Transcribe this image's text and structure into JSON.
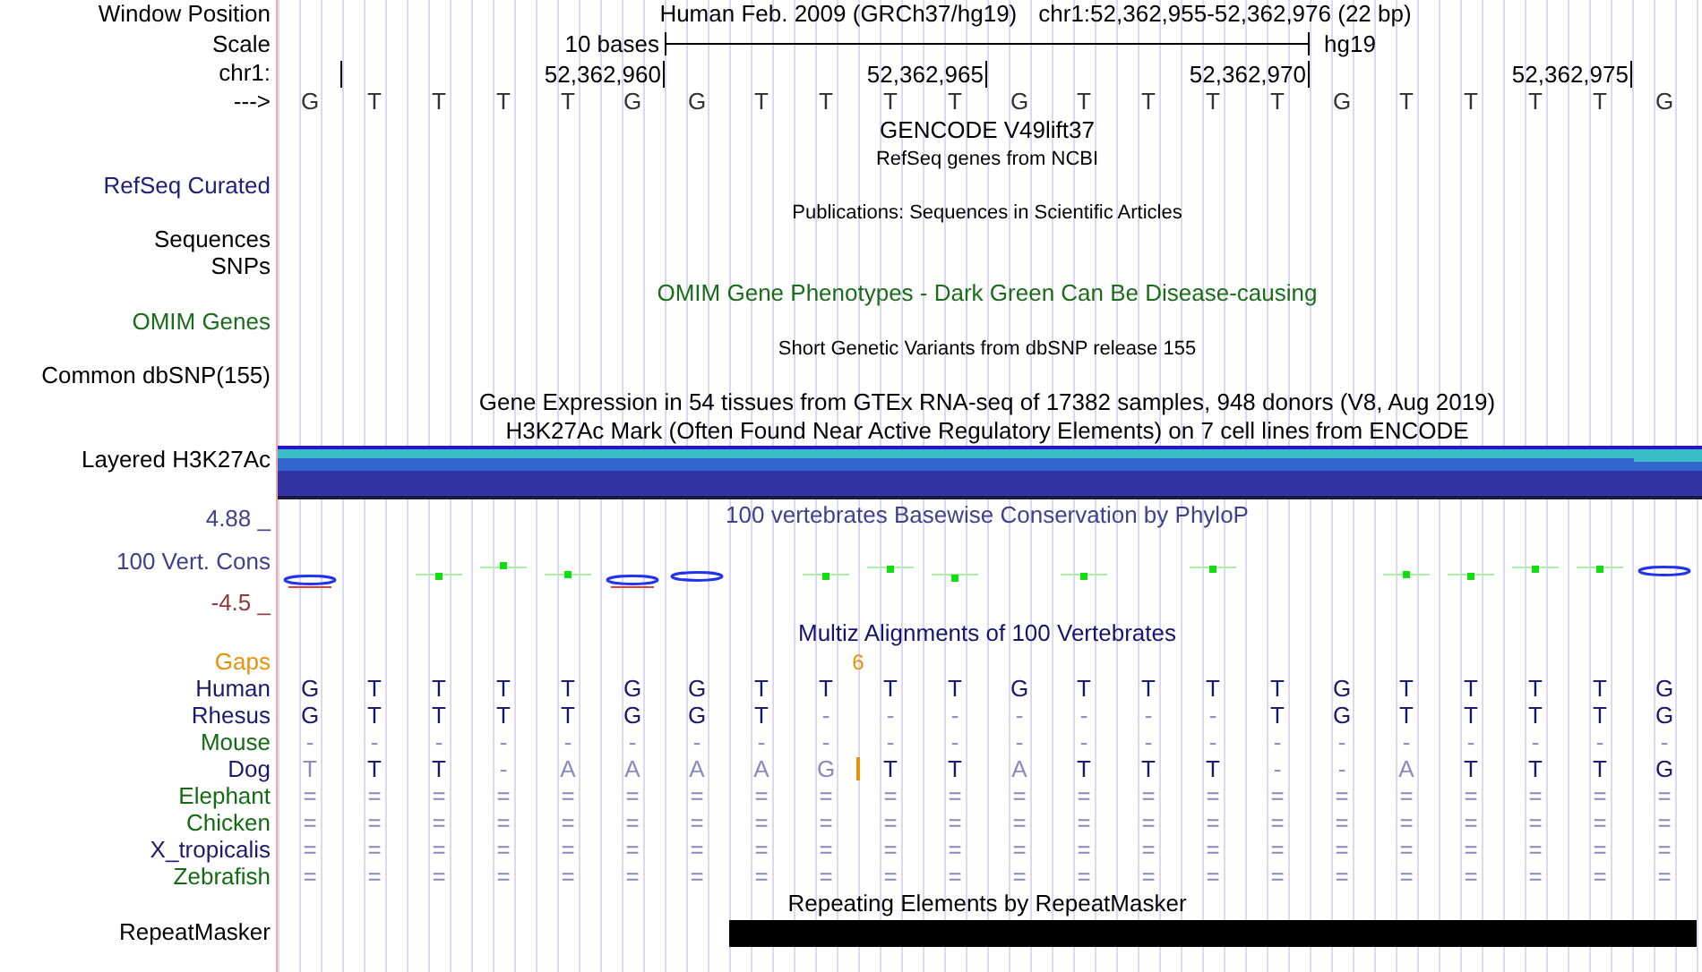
{
  "position": {
    "label": "Window Position",
    "assembly": "Human Feb. 2009 (GRCh37/hg19)",
    "range": "chr1:52,362,955-52,362,976 (22 bp)"
  },
  "scale": {
    "label": "Scale",
    "text": "10 bases",
    "db": "hg19"
  },
  "ruler": {
    "label": "chr1:",
    "ticks": [
      "52,362,960",
      "52,362,965",
      "52,362,970",
      "52,362,975"
    ]
  },
  "sequence": {
    "label": "--->",
    "bases": [
      "G",
      "T",
      "T",
      "T",
      "T",
      "G",
      "G",
      "T",
      "T",
      "T",
      "T",
      "G",
      "T",
      "T",
      "T",
      "T",
      "G",
      "T",
      "T",
      "T",
      "T",
      "G"
    ]
  },
  "tracks": [
    {
      "kind": "title",
      "text": "GENCODE V49lift37"
    },
    {
      "kind": "note",
      "text": "RefSeq genes from NCBI"
    },
    {
      "kind": "label",
      "label": "RefSeq Curated",
      "color": "#20207a"
    },
    {
      "kind": "note",
      "text": "Publications: Sequences in Scientific Articles"
    },
    {
      "kind": "label",
      "label": "Sequences"
    },
    {
      "kind": "label",
      "label": "SNPs"
    },
    {
      "kind": "title",
      "text": "OMIM Gene Phenotypes - Dark Green Can Be Disease-causing",
      "color": "#1a6b1a"
    },
    {
      "kind": "label",
      "label": "OMIM Genes",
      "color": "#1a6b1a"
    },
    {
      "kind": "note",
      "text": "Short Genetic Variants from dbSNP release 155"
    },
    {
      "kind": "label",
      "label": "Common dbSNP(155)"
    },
    {
      "kind": "title",
      "text": "Gene Expression in 54 tissues from GTEx RNA-seq of 17382 samples, 948 donors (V8, Aug 2019)"
    },
    {
      "kind": "title",
      "text": "H3K27Ac Mark (Often Found Near Active Regulatory Elements) on 7 cell lines from ENCODE"
    },
    {
      "kind": "layers",
      "label": "Layered H3K27Ac"
    },
    {
      "kind": "wiggle",
      "title": "100 vertebrates Basewise Conservation by PhyloP",
      "label": "100 Vert. Cons",
      "max": "4.88 _",
      "min": "-4.5 _",
      "color": "#40408c"
    },
    {
      "kind": "title",
      "text": "Multiz Alignments of 100 Vertebrates",
      "color": "#14146e"
    },
    {
      "kind": "gaps",
      "label": "Gaps",
      "color": "#e8900a",
      "marks": [
        {
          "text": "6"
        }
      ]
    },
    {
      "kind": "species",
      "label": "Human",
      "color": "#1a1a6e",
      "bases": [
        "G",
        "T",
        "T",
        "T",
        "T",
        "G",
        "G",
        "T",
        "T",
        "T",
        "T",
        "G",
        "T",
        "T",
        "T",
        "T",
        "G",
        "T",
        "T",
        "T",
        "T",
        "G"
      ]
    },
    {
      "kind": "species",
      "label": "Rhesus",
      "color": "#1a1a6e",
      "bases": [
        "G",
        "T",
        "T",
        "T",
        "T",
        "G",
        "G",
        "T",
        "-",
        "-",
        "-",
        "-",
        "-",
        "-",
        "-",
        "T",
        "G",
        "T",
        "T",
        "T",
        "T",
        "G"
      ]
    },
    {
      "kind": "species",
      "label": "Mouse",
      "color": "#126b12",
      "bases": [
        "-",
        "-",
        "-",
        "-",
        "-",
        "-",
        "-",
        "-",
        "-",
        "-",
        "-",
        "-",
        "-",
        "-",
        "-",
        "-",
        "-",
        "-",
        "-",
        "-",
        "-",
        "-"
      ]
    },
    {
      "kind": "species",
      "label": "Dog",
      "color": "#1a1a6e",
      "insertion": true,
      "bases": [
        "T",
        "T",
        "T",
        "-",
        "A",
        "A",
        "A",
        "A",
        "G",
        "T",
        "T",
        "A",
        "T",
        "T",
        "T",
        "-",
        "-",
        "A",
        "T",
        "T",
        "T",
        "G"
      ]
    },
    {
      "kind": "species",
      "label": "Elephant",
      "color": "#126b12",
      "bases": [
        "=",
        "=",
        "=",
        "=",
        "=",
        "=",
        "=",
        "=",
        "=",
        "=",
        "=",
        "=",
        "=",
        "=",
        "=",
        "=",
        "=",
        "=",
        "=",
        "=",
        "=",
        "="
      ]
    },
    {
      "kind": "species",
      "label": "Chicken",
      "color": "#126b12",
      "bases": [
        "=",
        "=",
        "=",
        "=",
        "=",
        "=",
        "=",
        "=",
        "=",
        "=",
        "=",
        "=",
        "=",
        "=",
        "=",
        "=",
        "=",
        "=",
        "=",
        "=",
        "=",
        "="
      ]
    },
    {
      "kind": "species",
      "label": "X_tropicalis",
      "color": "#1a1a6e",
      "bases": [
        "=",
        "=",
        "=",
        "=",
        "=",
        "=",
        "=",
        "=",
        "=",
        "=",
        "=",
        "=",
        "=",
        "=",
        "=",
        "=",
        "=",
        "=",
        "=",
        "=",
        "=",
        "="
      ]
    },
    {
      "kind": "species",
      "label": "Zebrafish",
      "color": "#126b12",
      "bases": [
        "=",
        "=",
        "=",
        "=",
        "=",
        "=",
        "=",
        "=",
        "=",
        "=",
        "=",
        "=",
        "=",
        "=",
        "=",
        "=",
        "=",
        "=",
        "=",
        "=",
        "=",
        "="
      ]
    },
    {
      "kind": "title",
      "text": "Repeating Elements by RepeatMasker"
    },
    {
      "kind": "repeats",
      "label": "RepeatMasker"
    }
  ]
}
